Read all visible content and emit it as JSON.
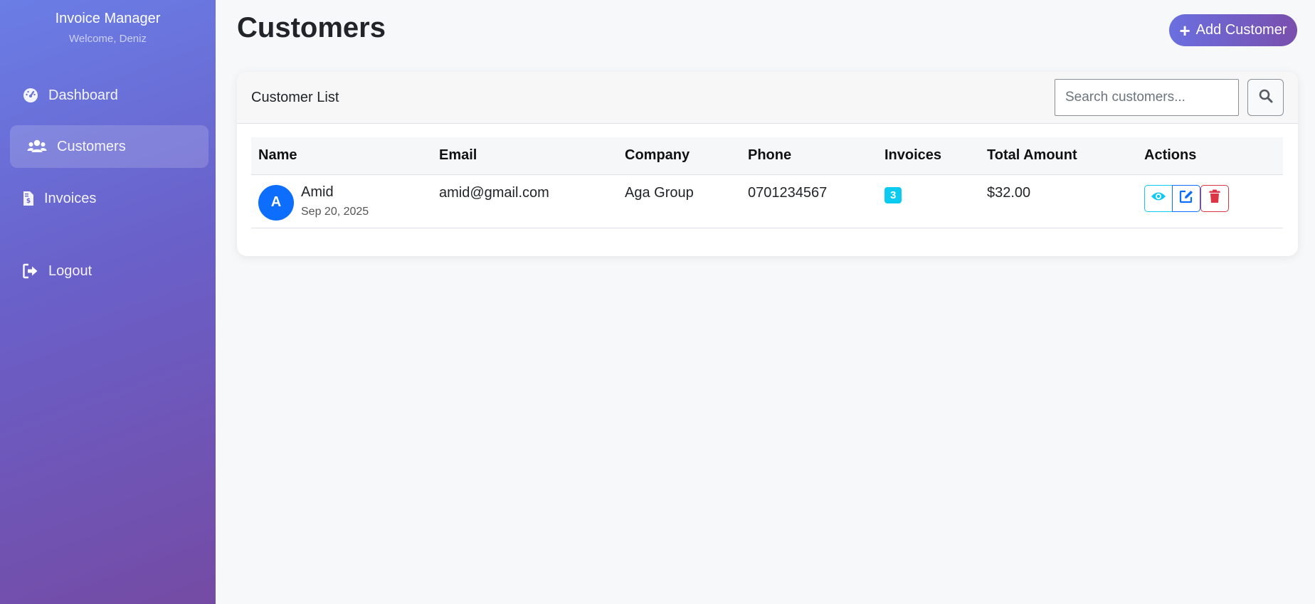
{
  "sidebar": {
    "app_title": "Invoice Manager",
    "welcome": "Welcome, Deniz",
    "items": [
      {
        "label": "Dashboard",
        "icon": "dashboard-gauge-icon",
        "active": false
      },
      {
        "label": "Customers",
        "icon": "users-icon",
        "active": true
      },
      {
        "label": "Invoices",
        "icon": "invoice-file-icon",
        "active": false
      },
      {
        "label": "Logout",
        "icon": "logout-icon",
        "active": false
      }
    ]
  },
  "header": {
    "title": "Customers",
    "add_button_label": "Add Customer"
  },
  "card": {
    "title": "Customer List",
    "search_placeholder": "Search customers...",
    "columns": [
      "Name",
      "Email",
      "Company",
      "Phone",
      "Invoices",
      "Total Amount",
      "Actions"
    ],
    "rows": [
      {
        "initial": "A",
        "name": "Amid",
        "date": "Sep 20, 2025",
        "email": "amid@gmail.com",
        "company": "Aga Group",
        "phone": "0701234567",
        "invoices": "3",
        "total": "$32.00"
      }
    ]
  },
  "colors": {
    "sidebar_gradient_start": "#6a7ee6",
    "sidebar_gradient_end": "#744ba4",
    "primary": "#0d6efd",
    "info": "#0dcaf0",
    "danger": "#dc3545"
  }
}
